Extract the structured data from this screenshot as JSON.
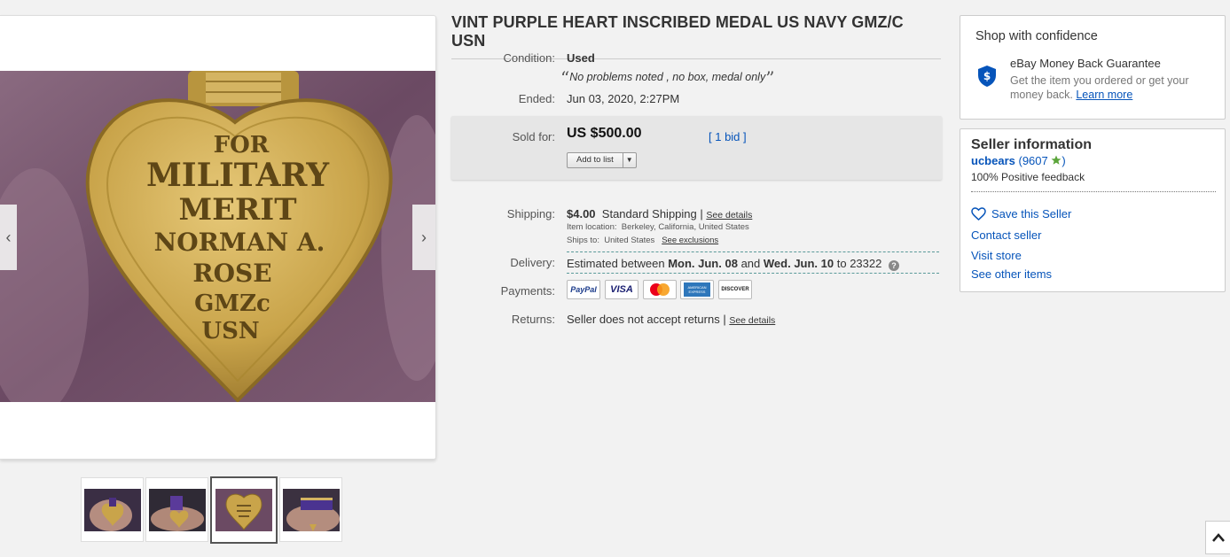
{
  "item": {
    "title": "VINT PURPLE HEART INSCRIBED MEDAL US NAVY GMZ/C USN",
    "condition_label": "Condition:",
    "condition_value": "Used",
    "condition_note": "No problems noted , no box, medal only",
    "ended_label": "Ended:",
    "ended_value": "Jun 03, 2020, 2:27PM",
    "sold_label": "Sold for:",
    "price": "US $500.00",
    "bids": "[ 1 bid ]",
    "add_to_list": "Add to list",
    "shipping_label": "Shipping:",
    "shipping_cost": "$4.00",
    "shipping_method": "Standard Shipping |",
    "see_details": "See details",
    "item_location_label": "Item location:",
    "item_location": "Berkeley, California, United States",
    "ships_to_label": "Ships to:",
    "ships_to": "United States",
    "see_exclusions": "See exclusions",
    "delivery_label": "Delivery:",
    "delivery_prefix": "Estimated between",
    "delivery_start": "Mon. Jun. 08",
    "delivery_and": "and",
    "delivery_end": "Wed. Jun. 10",
    "delivery_to": "to 23322",
    "payments_label": "Payments:",
    "payments": [
      "PayPal",
      "VISA",
      "Mastercard",
      "American Express",
      "DISCOVER"
    ],
    "returns_label": "Returns:",
    "returns_value": "Seller does not accept returns |",
    "returns_details": "See details"
  },
  "medal_engraving": [
    "FOR",
    "MILITARY",
    "MERIT",
    "NORMAN A.",
    "ROSE",
    "GMZc",
    "USN"
  ],
  "gallery": {
    "thumbnails": [
      "thumbnail-1",
      "thumbnail-2",
      "thumbnail-3",
      "thumbnail-4"
    ],
    "active_index": 2
  },
  "confidence": {
    "heading": "Shop with confidence",
    "guarantee_title": "eBay Money Back Guarantee",
    "guarantee_desc": "Get the item you ordered or get your money back.",
    "learn_more": "Learn more"
  },
  "seller": {
    "heading": "Seller information",
    "username": "ucbears",
    "feedback_score": "(9607",
    "feedback_close": ")",
    "positive": "100% Positive feedback",
    "save_seller": "Save this Seller",
    "contact": "Contact seller",
    "visit_store": "Visit store",
    "other_items": "See other items"
  },
  "colors": {
    "link": "#0654ba",
    "medal_gold": "#c9a44a",
    "background_purple": "#6b4a63",
    "star_green": "#5ba53a"
  }
}
